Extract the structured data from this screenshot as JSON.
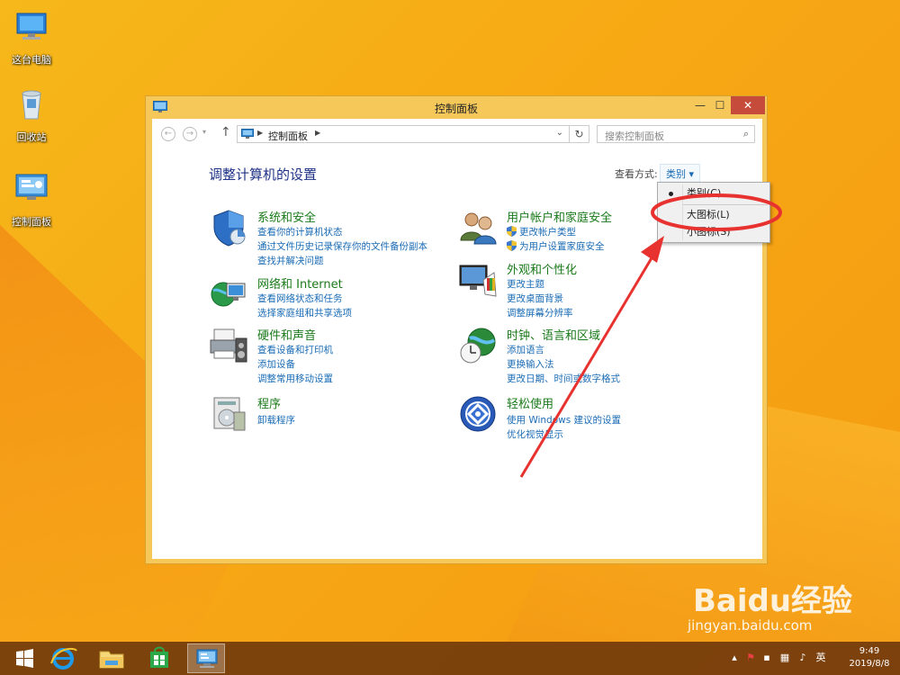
{
  "desktop": {
    "icons": [
      {
        "label": "这台电脑",
        "icon": "computer-icon"
      },
      {
        "label": "回收站",
        "icon": "recycle-bin-icon"
      },
      {
        "label": "控制面板",
        "icon": "control-panel-icon"
      }
    ]
  },
  "window": {
    "title": "控制面板",
    "controls": {
      "minimize": "—",
      "maximize": "☐",
      "close": "✕"
    },
    "address": {
      "crumb": "控制面板"
    },
    "search_placeholder": "搜索控制面板"
  },
  "main": {
    "heading": "调整计算机的设置",
    "view_by_label": "查看方式:",
    "view_by_value": "类别 ▾",
    "categories": [
      {
        "name": "系统和安全",
        "links": [
          "查看你的计算机状态",
          "通过文件历史记录保存你的文件备份副本",
          "查找并解决问题"
        ]
      },
      {
        "name": "网络和 Internet",
        "links": [
          "查看网络状态和任务",
          "选择家庭组和共享选项"
        ]
      },
      {
        "name": "硬件和声音",
        "links": [
          "查看设备和打印机",
          "添加设备",
          "调整常用移动设置"
        ]
      },
      {
        "name": "程序",
        "links": [
          "卸载程序"
        ]
      },
      {
        "name": "用户帐户和家庭安全",
        "links": [
          "更改帐户类型",
          "为用户设置家庭安全"
        ]
      },
      {
        "name": "外观和个性化",
        "links": [
          "更改主题",
          "更改桌面背景",
          "调整屏幕分辨率"
        ]
      },
      {
        "name": "时钟、语言和区域",
        "links": [
          "添加语言",
          "更换输入法",
          "更改日期、时间或数字格式"
        ]
      },
      {
        "name": "轻松使用",
        "links": [
          "使用 Windows 建议的设置",
          "优化视觉显示"
        ]
      }
    ]
  },
  "view_menu": {
    "items": [
      "类别(C)",
      "大图标(L)",
      "小图标(S)"
    ],
    "selected": "类别(C)"
  },
  "taskbar": {
    "clock_time": "9:49",
    "clock_date": "2019/8/8"
  },
  "watermark": {
    "brand": "Baidu经验",
    "url": "jingyan.baidu.com"
  },
  "colors": {
    "desktop": "#f7a814",
    "window_frame": "#f6c85a",
    "close_button": "#c74b3b",
    "category_title": "#1a7a1a",
    "link": "#1a6bb5",
    "heading": "#1e3287",
    "annotation": "#e8322f"
  }
}
